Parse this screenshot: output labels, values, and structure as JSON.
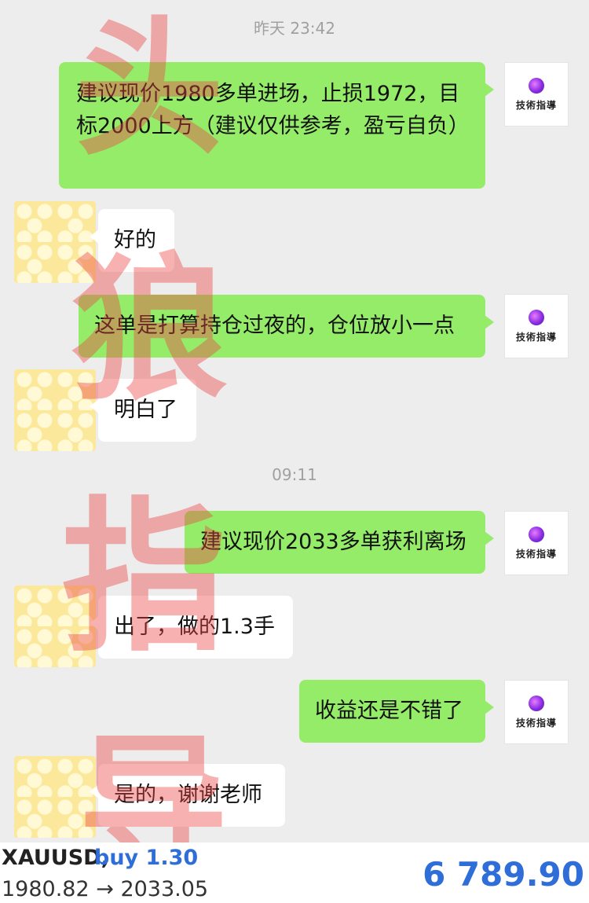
{
  "timestamps": [
    "昨天 23:42",
    "09:11"
  ],
  "messages": [
    {
      "from": "me",
      "text": "建议现价1980多单进场，止损1972，目标2000上方（建议仅供参考，盈亏自负）"
    },
    {
      "from": "them",
      "text": "好的"
    },
    {
      "from": "me",
      "text": "这单是打算持仓过夜的，仓位放小一点"
    },
    {
      "from": "them",
      "text": "明白了"
    },
    {
      "from": "me",
      "text": "建议现价2033多单获利离场"
    },
    {
      "from": "them",
      "text": "出了，做的1.3手"
    },
    {
      "from": "me",
      "text": "收益还是不错了"
    },
    {
      "from": "them",
      "text": "是的，谢谢老师"
    }
  ],
  "avatar_right_label": "技術指導",
  "watermark": [
    "头",
    "狼",
    "指",
    "导"
  ],
  "trade": {
    "symbol": "XAUUSD,",
    "side": "buy 1.30",
    "prices": "1980.82 → 2033.05",
    "profit": "6 789.90"
  },
  "colors": {
    "background": "#ededed",
    "my_bubble": "#95ec69",
    "their_bubble": "#ffffff",
    "profit_blue": "#2f6ed8",
    "watermark": "#eb4646"
  }
}
